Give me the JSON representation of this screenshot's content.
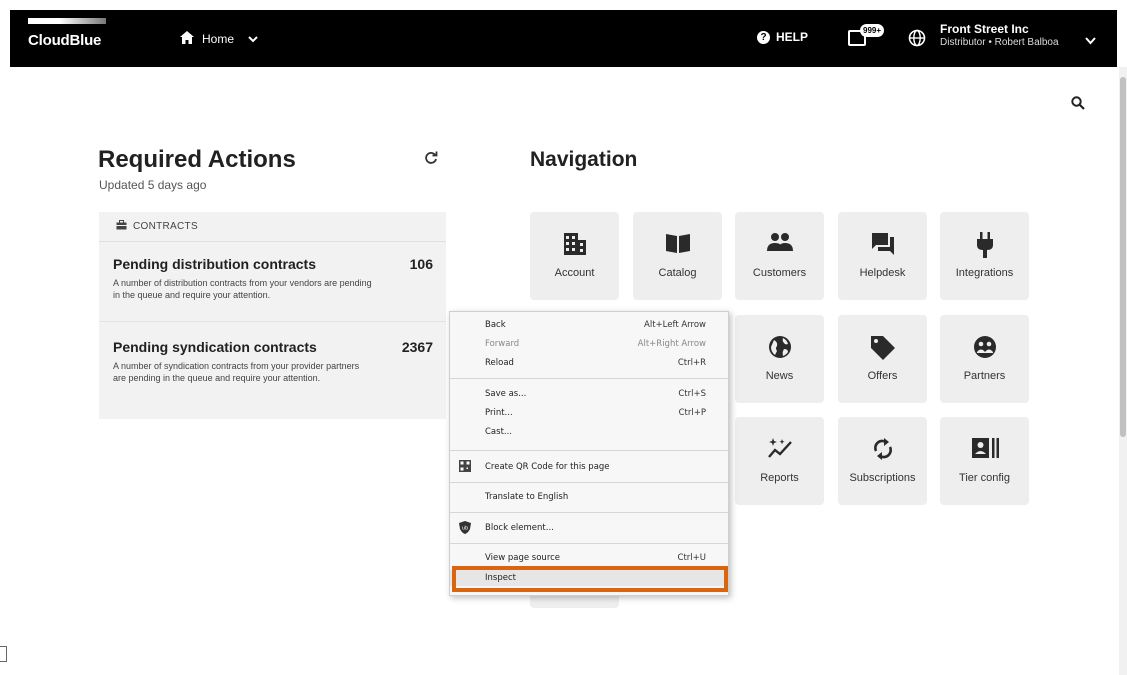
{
  "header": {
    "logo_text": "CloudBlue",
    "home_label": "Home",
    "help_label": "HELP",
    "notifications_badge": "999+",
    "account_name": "Front Street Inc",
    "account_sub": "Distributor • Robert Balboa"
  },
  "required_actions": {
    "title": "Required Actions",
    "updated": "Updated 5 days ago",
    "section_label": "CONTRACTS",
    "items": [
      {
        "title": "Pending distribution contracts",
        "count": "106",
        "description": "A number of distribution contracts from your vendors are pending in the queue and require your attention."
      },
      {
        "title": "Pending syndication contracts",
        "count": "2367",
        "description": "A number of syndication contracts from your provider partners are pending in the queue and require your attention."
      }
    ]
  },
  "navigation": {
    "title": "Navigation",
    "tiles": [
      {
        "label": "Account",
        "icon": "building-icon"
      },
      {
        "label": "Catalog",
        "icon": "book-icon"
      },
      {
        "label": "Customers",
        "icon": "people-icon"
      },
      {
        "label": "Helpdesk",
        "icon": "chat-icon"
      },
      {
        "label": "Integrations",
        "icon": "plug-icon"
      },
      {
        "label": "News",
        "icon": "globe-icon"
      },
      {
        "label": "Offers",
        "icon": "tag-icon"
      },
      {
        "label": "Partners",
        "icon": "handshake-icon"
      },
      {
        "label": "Reports",
        "icon": "sparkle-chart-icon"
      },
      {
        "label": "Subscriptions",
        "icon": "sync-icon"
      },
      {
        "label": "Tier config",
        "icon": "id-card-icon"
      }
    ]
  },
  "context_menu": {
    "items": [
      {
        "label": "Back",
        "shortcut": "Alt+Left Arrow"
      },
      {
        "label": "Forward",
        "shortcut": "Alt+Right Arrow"
      },
      {
        "label": "Reload",
        "shortcut": "Ctrl+R"
      },
      {
        "label": "Save as...",
        "shortcut": "Ctrl+S"
      },
      {
        "label": "Print...",
        "shortcut": "Ctrl+P"
      },
      {
        "label": "Cast...",
        "shortcut": ""
      },
      {
        "label": "Create QR Code for this page",
        "shortcut": ""
      },
      {
        "label": "Translate to English",
        "shortcut": ""
      },
      {
        "label": "Block element...",
        "shortcut": ""
      },
      {
        "label": "View page source",
        "shortcut": "Ctrl+U"
      },
      {
        "label": "Inspect",
        "shortcut": ""
      }
    ],
    "highlight_color": "#d9650e"
  }
}
